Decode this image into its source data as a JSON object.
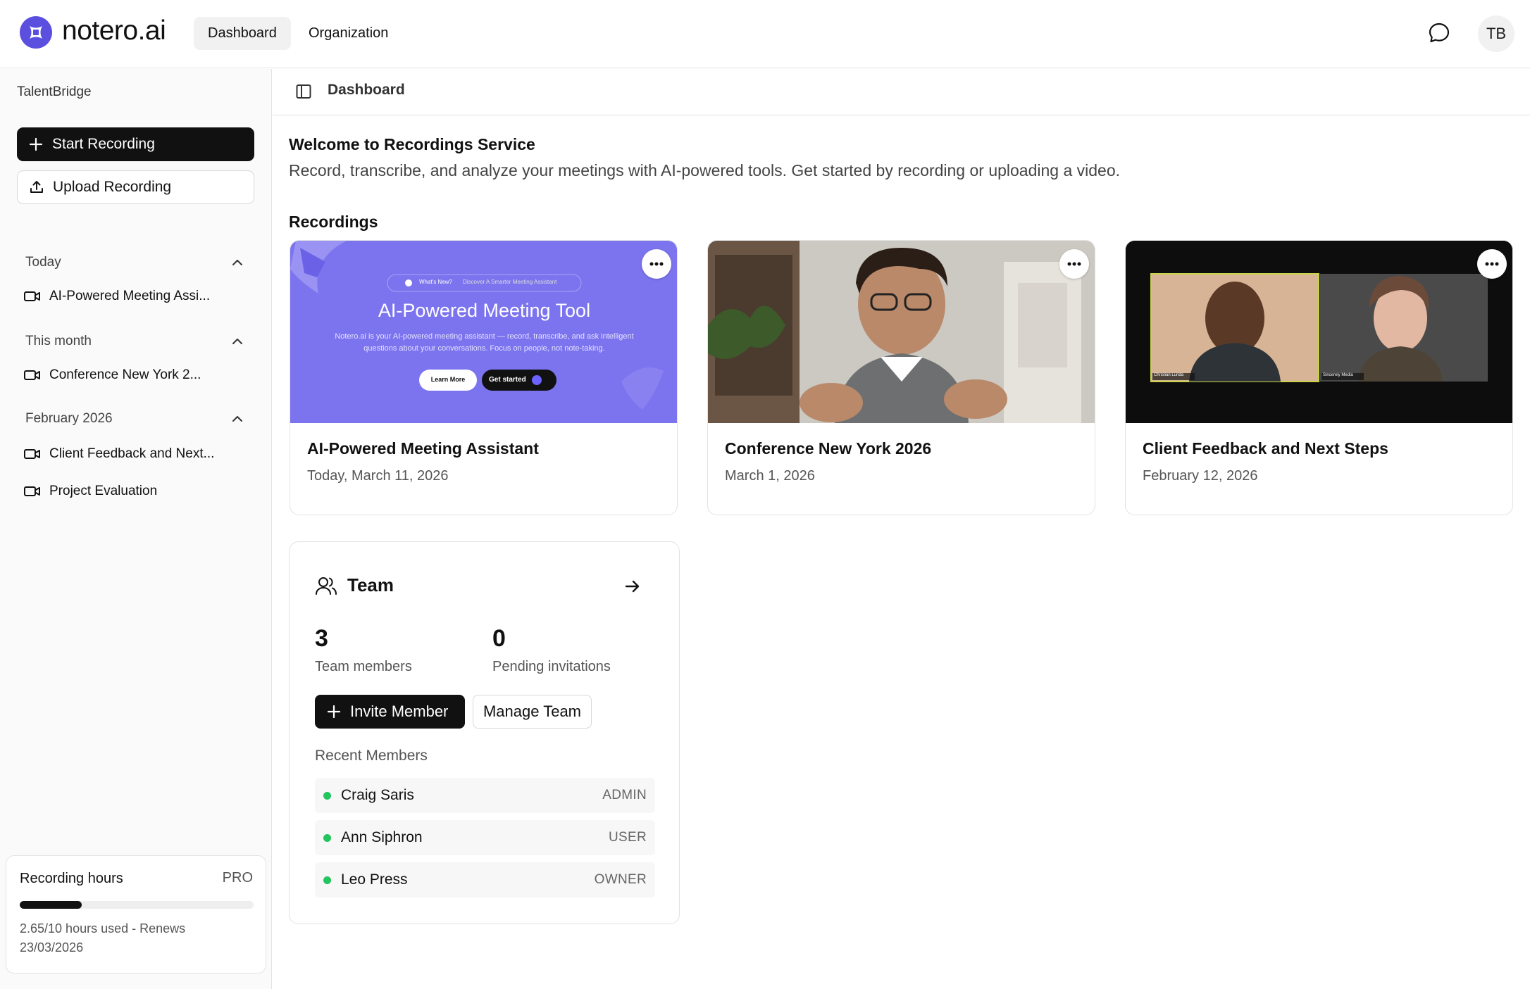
{
  "app": {
    "brand": "notero.ai",
    "accent": "#5b4fe0"
  },
  "topnav": {
    "dashboard": "Dashboard",
    "organization": "Organization",
    "avatar_initials": "TB"
  },
  "sidebar": {
    "org_name": "TalentBridge",
    "start_recording": "Start Recording",
    "upload_recording": "Upload Recording",
    "groups": [
      {
        "label": "Today",
        "items": [
          "AI-Powered Meeting Assi..."
        ]
      },
      {
        "label": "This month",
        "items": [
          "Conference New York 2..."
        ]
      },
      {
        "label": "February 2026",
        "items": [
          "Client Feedback and Next...",
          "Project Evaluation"
        ]
      }
    ],
    "usage": {
      "title": "Recording hours",
      "plan": "PRO",
      "used": 2.65,
      "limit": 10,
      "text": "2.65/10 hours used - Renews 23/03/2026"
    }
  },
  "breadcrumb": {
    "title": "Dashboard"
  },
  "welcome": {
    "title": "Welcome to Recordings Service",
    "subtitle": "Record, transcribe, and analyze your meetings with AI-powered tools. Get started by recording or uploading a video."
  },
  "recordings": {
    "section_title": "Recordings",
    "items": [
      {
        "title": "AI-Powered Meeting Assistant",
        "date": "Today, March 11, 2026",
        "thumb": {
          "pill_left": "What's New?",
          "pill_right": "Discover A Smarter Meeting Assistant",
          "heading": "AI-Powered Meeting Tool",
          "body": "Notero.ai is your AI-powered meeting assistant — record, transcribe, and ask intelligent questions about your conversations. Focus on people, not note-taking.",
          "btn_learn": "Learn More",
          "btn_start": "Get started"
        }
      },
      {
        "title": "Conference New York 2026",
        "date": "March 1, 2026"
      },
      {
        "title": "Client Feedback and Next Steps",
        "date": "February 12, 2026",
        "thumb": {
          "tile_left": "Christian Lunda",
          "tile_right": "Sincerely Media"
        }
      }
    ]
  },
  "team": {
    "title": "Team",
    "members_count": "3",
    "members_label": "Team members",
    "pending_count": "0",
    "pending_label": "Pending invitations",
    "invite_btn": "Invite Member",
    "manage_btn": "Manage Team",
    "recent_label": "Recent Members",
    "recent": [
      {
        "name": "Craig Saris",
        "role": "ADMIN"
      },
      {
        "name": "Ann Siphron",
        "role": "USER"
      },
      {
        "name": "Leo Press",
        "role": "OWNER"
      }
    ]
  }
}
